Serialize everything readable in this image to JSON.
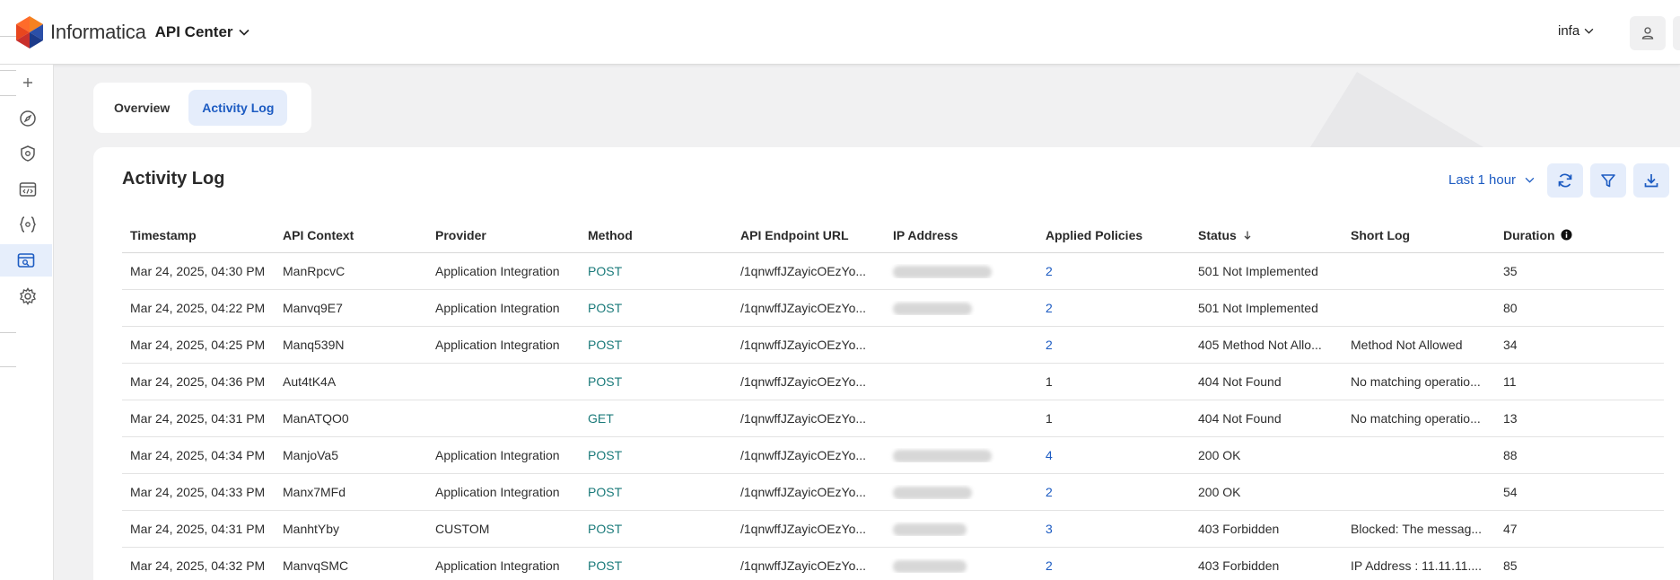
{
  "header": {
    "brand": "Informatica",
    "app_name": "API Center",
    "user": "infa"
  },
  "tabs": [
    {
      "label": "Overview",
      "active": false
    },
    {
      "label": "Activity Log",
      "active": true
    }
  ],
  "card": {
    "title": "Activity Log",
    "time_range": "Last 1 hour"
  },
  "table": {
    "columns": [
      "Timestamp",
      "API Context",
      "Provider",
      "Method",
      "API Endpoint URL",
      "IP Address",
      "Applied Policies",
      "Status",
      "Short Log",
      "Duration"
    ],
    "rows": [
      {
        "timestamp": "Mar 24, 2025, 04:30 PM",
        "context": "ManRpcvC",
        "provider": "Application Integration",
        "method": "POST",
        "url": "/1qnwffJZayicOEzYo...",
        "policies": "2",
        "policies_link": true,
        "status": "501 Not Implemented",
        "short_log": "",
        "duration": "35"
      },
      {
        "timestamp": "Mar 24, 2025, 04:22 PM",
        "context": "Manvq9E7",
        "provider": "Application Integration",
        "method": "POST",
        "url": "/1qnwffJZayicOEzYo...",
        "policies": "2",
        "policies_link": true,
        "status": "501 Not Implemented",
        "short_log": "",
        "duration": "80"
      },
      {
        "timestamp": "Mar 24, 2025, 04:25 PM",
        "context": "Manq539N",
        "provider": "Application Integration",
        "method": "POST",
        "url": "/1qnwffJZayicOEzYo...",
        "policies": "2",
        "policies_link": true,
        "status": "405 Method Not Allo...",
        "short_log": "Method Not Allowed",
        "duration": "34"
      },
      {
        "timestamp": "Mar 24, 2025, 04:36 PM",
        "context": "Aut4tK4A",
        "provider": "",
        "method": "POST",
        "url": "/1qnwffJZayicOEzYo...",
        "policies": "1",
        "policies_link": false,
        "status": "404 Not Found",
        "short_log": "No matching operatio...",
        "duration": "11"
      },
      {
        "timestamp": "Mar 24, 2025, 04:31 PM",
        "context": "ManATQO0",
        "provider": "",
        "method": "GET",
        "url": "/1qnwffJZayicOEzYo...",
        "policies": "1",
        "policies_link": false,
        "status": "404 Not Found",
        "short_log": "No matching operatio...",
        "duration": "13"
      },
      {
        "timestamp": "Mar 24, 2025, 04:34 PM",
        "context": "ManjoVa5",
        "provider": "Application Integration",
        "method": "POST",
        "url": "/1qnwffJZayicOEzYo...",
        "policies": "4",
        "policies_link": true,
        "status": "200 OK",
        "short_log": "",
        "duration": "88"
      },
      {
        "timestamp": "Mar 24, 2025, 04:33 PM",
        "context": "Manx7MFd",
        "provider": "Application Integration",
        "method": "POST",
        "url": "/1qnwffJZayicOEzYo...",
        "policies": "2",
        "policies_link": true,
        "status": "200 OK",
        "short_log": "",
        "duration": "54"
      },
      {
        "timestamp": "Mar 24, 2025, 04:31 PM",
        "context": "ManhtYby",
        "provider": "CUSTOM",
        "method": "POST",
        "url": "/1qnwffJZayicOEzYo...",
        "policies": "3",
        "policies_link": true,
        "status": "403 Forbidden",
        "short_log": "Blocked: The messag...",
        "duration": "47"
      },
      {
        "timestamp": "Mar 24, 2025, 04:32 PM",
        "context": "ManvqSMC",
        "provider": "Application Integration",
        "method": "POST",
        "url": "/1qnwffJZayicOEzYo...",
        "policies": "2",
        "policies_link": true,
        "status": "403 Forbidden",
        "short_log": "IP Address : 11.11.11....",
        "duration": "85"
      }
    ]
  },
  "colors": {
    "accent": "#1c5bc2",
    "method": "#1a7a7a",
    "tab_active_bg": "#e5edfb"
  },
  "icons": {
    "sidebar": [
      "plus-icon",
      "compass-icon",
      "shield-gear-icon",
      "code-window-icon",
      "code-braces-icon",
      "api-window-icon",
      "gear-icon"
    ],
    "toolbar": [
      "refresh-icon",
      "filter-icon",
      "download-icon"
    ]
  }
}
